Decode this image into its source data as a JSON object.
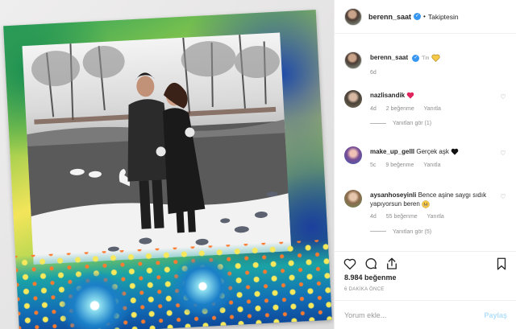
{
  "header": {
    "username": "berenn_saat",
    "verified_glyph": "✓",
    "dot": "•",
    "follow_status": "Takiptesin"
  },
  "caption": {
    "username": "berenn_saat",
    "verified_glyph": "✓",
    "text": "'Tm",
    "emoji": "yellow-heart-icon",
    "age": "6d"
  },
  "comments": [
    {
      "username": "nazlisandik",
      "text": "",
      "emoji": "red-heart-icon",
      "meta": [
        "4d",
        "2 beğenme",
        "Yanıtla"
      ],
      "replies": "Yanıtları gör (1)"
    },
    {
      "username": "make_up_gelll",
      "text": "Gerçek aşk",
      "emoji": "black-heart-icon",
      "meta": [
        "5c",
        "9 beğenme",
        "Yanıtla"
      ],
      "replies": ""
    },
    {
      "username": "aysanhoseyinli",
      "text": "Bence aşine saygı sıdık yapıyorsun beren",
      "emoji": "grinning-face-icon",
      "meta": [
        "4d",
        "55 beğenme",
        "Yanıtla"
      ],
      "replies": "Yanıtları gör (5)"
    }
  ],
  "likes": "8.984 beğenme",
  "time": "6 DAKİKA ÖNCE",
  "add_comment": {
    "placeholder": "Yorum ekle...",
    "post_label": "Paylaş"
  },
  "colors": {
    "verified": "#3897f0",
    "muted": "#8e8e8e",
    "post_disabled": "#b2dffc"
  }
}
